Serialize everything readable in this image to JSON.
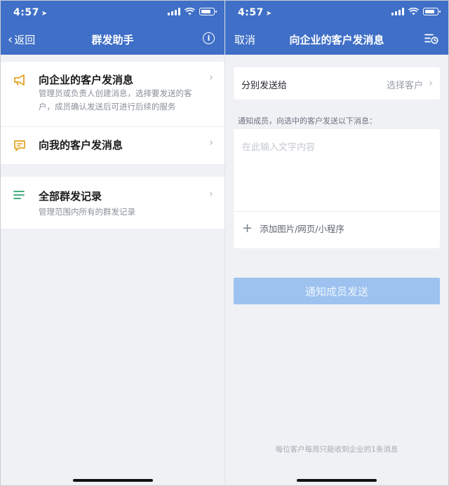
{
  "left": {
    "status": {
      "time": "4:57"
    },
    "nav": {
      "back_label": "返回",
      "title": "群发助手"
    },
    "items": [
      {
        "title": "向企业的客户发消息",
        "desc": "管理员或负责人创建消息，选择要发送的客户，成员确认发送后可进行后续的服务",
        "icon": "megaphone-icon"
      },
      {
        "title": "向我的客户发消息",
        "desc": "",
        "icon": "message-icon"
      },
      {
        "title": "全部群发记录",
        "desc": "管理范围内所有的群发记录",
        "icon": "list-icon"
      }
    ]
  },
  "right": {
    "status": {
      "time": "4:57"
    },
    "nav": {
      "cancel_label": "取消",
      "title": "向企业的客户发消息"
    },
    "send_to": {
      "label": "分别发送给",
      "value": "选择客户"
    },
    "hint": "通知成员，向选中的客户发送以下消息：",
    "message_placeholder": "在此输入文字内容",
    "add_media_label": "添加图片/网页/小程序",
    "send_button": "通知成员发送",
    "footer_note": "每位客户每周只能收到企业的1条消息"
  },
  "colors": {
    "nav_bg": "#3f6fc7",
    "page_bg": "#f0f1f4",
    "megaphone_icon": "#e3a322",
    "message_icon": "#e3a322",
    "list_icon": "#2aa36b",
    "send_button_bg": "#9dc2ef"
  }
}
